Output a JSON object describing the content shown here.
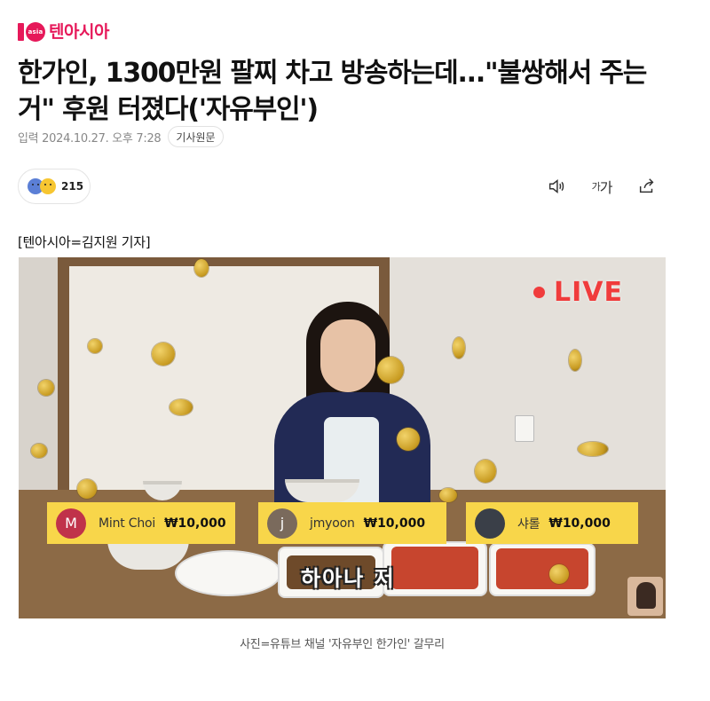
{
  "site": {
    "logo_mark_text": "asia",
    "logo_text": "텐아시아",
    "brand_color": "#e6195a"
  },
  "article": {
    "headline": "한가인, 1300만원 팔찌 차고 방송하는데...\"불쌍해서 주는 거\" 후원 터졌다('자유부인')",
    "date": "입력 2024.10.27. 오후 7:28",
    "source_button": "기사원문",
    "reaction_count": "215",
    "byline": "[텐아시아=김지원 기자]",
    "caption": "사진=유튜브 채널 '자유부인 한가인' 갈무리"
  },
  "toolbar": {
    "icons": [
      "speaker-icon",
      "font-size-icon",
      "share-icon"
    ],
    "font_label_small": "가",
    "font_label_large": "가"
  },
  "photo": {
    "live_label": "LIVE",
    "live_color": "#f03c3c",
    "subtitle": "하아나 저",
    "donations": [
      {
        "initial": "M",
        "name": "Mint Choi",
        "amount": "₩10,000",
        "avatar_color": "#c0324a"
      },
      {
        "initial": "j",
        "name": "jmyoon",
        "amount": "₩10,000",
        "avatar_color": "#7a6a5c"
      },
      {
        "initial": "",
        "name": "샤롤",
        "amount": "₩10,000",
        "avatar_color": "#3a3f48"
      }
    ],
    "donation_bg": "#f8d64a"
  }
}
